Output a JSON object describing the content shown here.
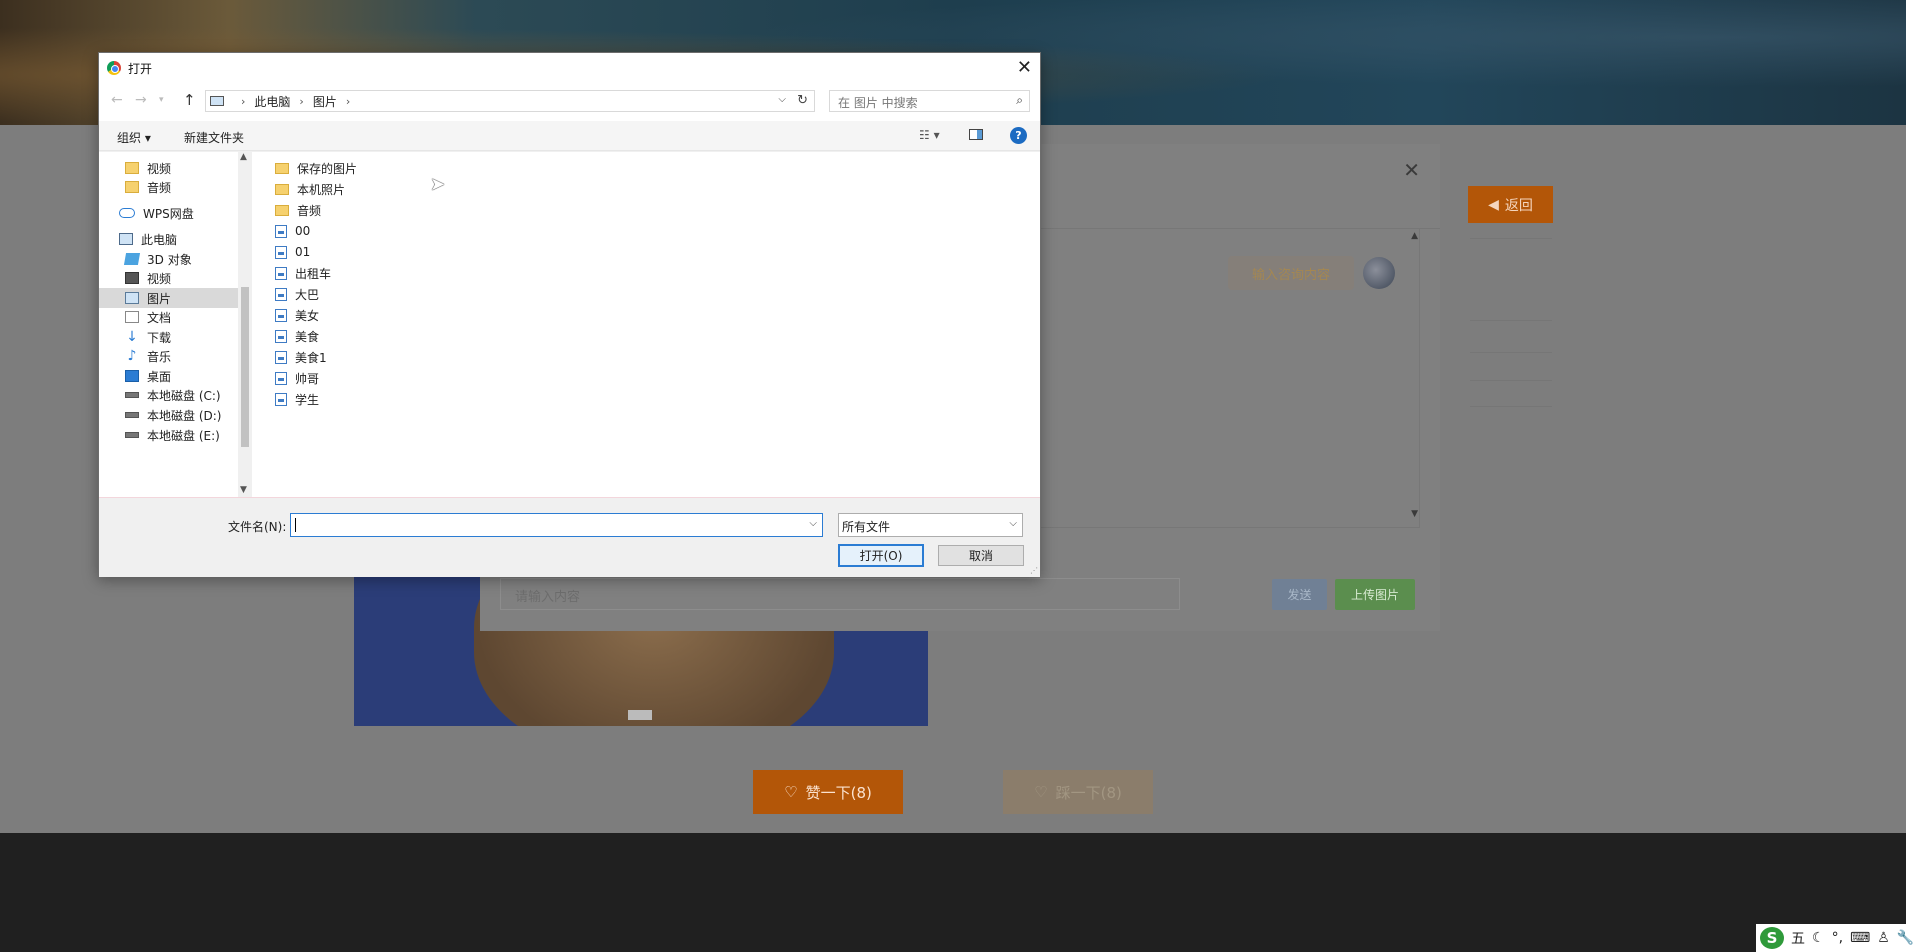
{
  "page": {
    "back_label": "返回",
    "like_label": "赞一下(8)",
    "dislike_label": "踩一下(8)"
  },
  "chat": {
    "bubble_text": "输入咨询内容",
    "input_placeholder": "请输入内容",
    "send_label": "发送",
    "upload_label": "上传图片"
  },
  "dialog": {
    "title": "打开",
    "breadcrumb": [
      "此电脑",
      "图片"
    ],
    "search_placeholder": "在 图片 中搜索",
    "toolbar": {
      "organize": "组织 ▾",
      "new_folder": "新建文件夹",
      "help": "?"
    },
    "nav_items": [
      {
        "label": "视频",
        "icon": "folder-icon"
      },
      {
        "label": "音频",
        "icon": "folder-icon"
      },
      {
        "label": "WPS网盘",
        "icon": "cloud-icon"
      },
      {
        "label": "此电脑",
        "icon": "pc-icon"
      },
      {
        "label": "3D 对象",
        "icon": "3d-objects-icon"
      },
      {
        "label": "视频",
        "icon": "video-icon"
      },
      {
        "label": "图片",
        "icon": "pictures-icon",
        "selected": true
      },
      {
        "label": "文档",
        "icon": "document-icon"
      },
      {
        "label": "下载",
        "icon": "download-icon"
      },
      {
        "label": "音乐",
        "icon": "music-icon"
      },
      {
        "label": "桌面",
        "icon": "desktop-icon"
      },
      {
        "label": "本地磁盘 (C:)",
        "icon": "drive-icon"
      },
      {
        "label": "本地磁盘 (D:)",
        "icon": "drive-icon"
      },
      {
        "label": "本地磁盘 (E:)",
        "icon": "drive-icon"
      }
    ],
    "files": [
      {
        "name": "保存的图片",
        "type": "folder"
      },
      {
        "name": "本机照片",
        "type": "folder"
      },
      {
        "name": "音频",
        "type": "folder"
      },
      {
        "name": "00",
        "type": "file"
      },
      {
        "name": "01",
        "type": "file"
      },
      {
        "name": "出租车",
        "type": "file"
      },
      {
        "name": "大巴",
        "type": "file"
      },
      {
        "name": "美女",
        "type": "file"
      },
      {
        "name": "美食",
        "type": "file"
      },
      {
        "name": "美食1",
        "type": "file"
      },
      {
        "name": "帅哥",
        "type": "file"
      },
      {
        "name": "学生",
        "type": "file"
      }
    ],
    "filename_label": "文件名(N):",
    "filename_value": "",
    "filetype_value": "所有文件",
    "open_label": "打开(O)",
    "cancel_label": "取消"
  },
  "taskbar": {
    "ime_mode": "五"
  }
}
